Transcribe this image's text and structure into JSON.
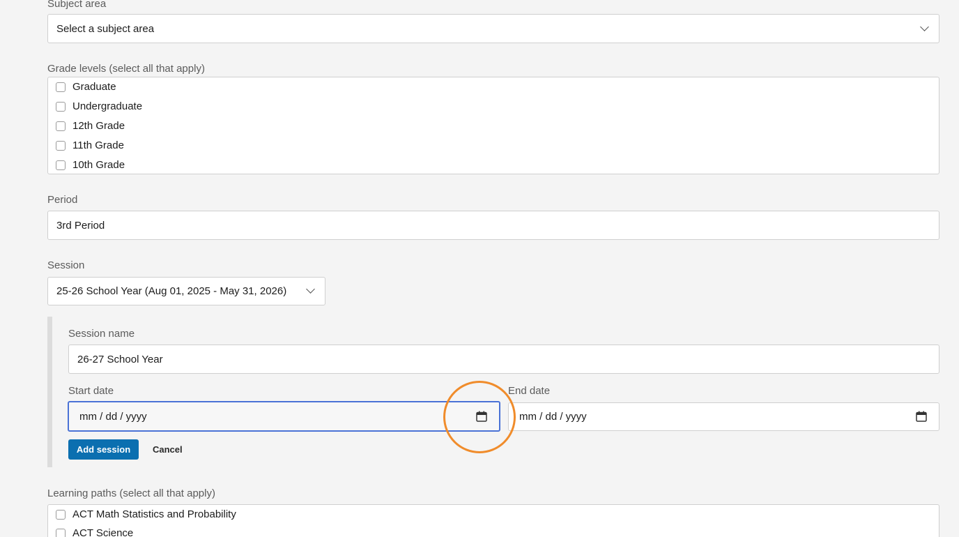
{
  "subject_area": {
    "label": "Subject area",
    "placeholder": "Select a subject area"
  },
  "grade_levels": {
    "label": "Grade levels (select all that apply)",
    "options": [
      "Graduate",
      "Undergraduate",
      "12th Grade",
      "11th Grade",
      "10th Grade"
    ]
  },
  "period": {
    "label": "Period",
    "value": "3rd Period"
  },
  "session": {
    "label": "Session",
    "selected": "25-26 School Year (Aug 01, 2025 - May 31, 2026)"
  },
  "new_session": {
    "name_label": "Session name",
    "name_value": "26-27 School Year",
    "start_label": "Start date",
    "start_placeholder": "mm / dd / yyyy",
    "end_label": "End date",
    "end_placeholder": "mm / dd / yyyy",
    "add_button": "Add session",
    "cancel_button": "Cancel"
  },
  "learning_paths": {
    "label": "Learning paths (select all that apply)",
    "options": [
      "ACT Math Statistics and Probability",
      "ACT Science"
    ]
  },
  "colors": {
    "primary": "#0b6fb0",
    "focus_border": "#4a72d6",
    "highlight_ring": "#f08c2b"
  }
}
